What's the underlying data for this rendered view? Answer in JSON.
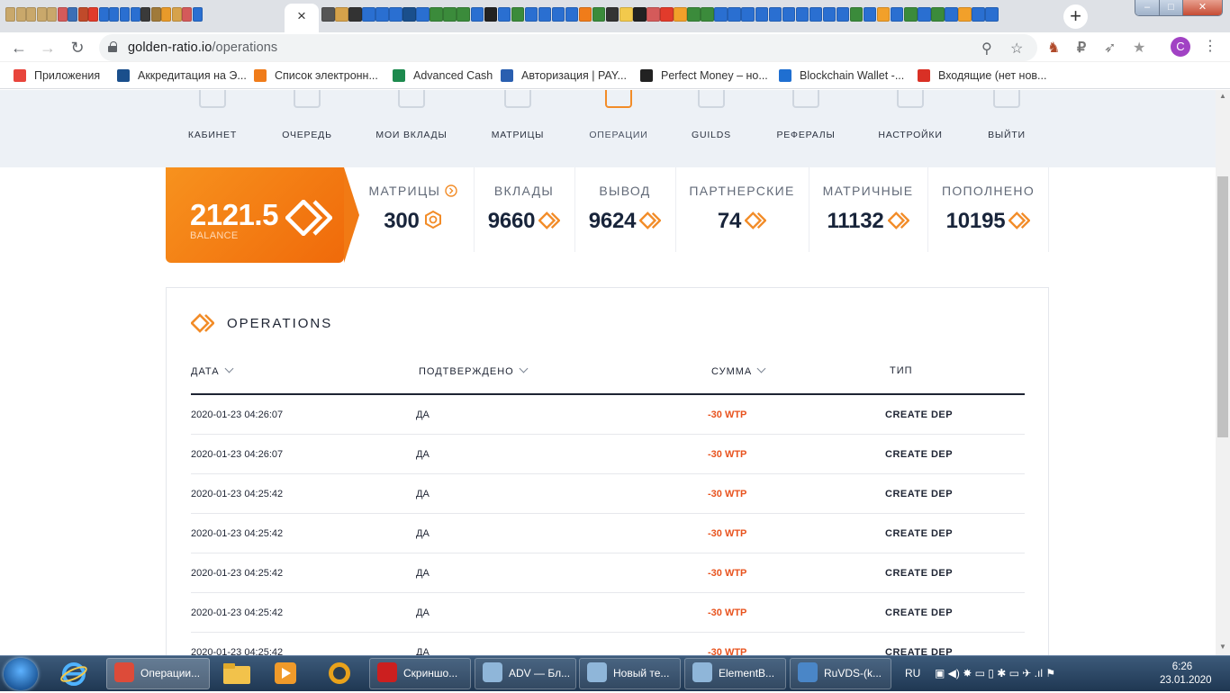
{
  "browser": {
    "active_tab_close": "×",
    "new_tab": "+",
    "url_host": "golden-ratio.io",
    "url_path": "/operations",
    "window_controls": {
      "minimize": "–",
      "maximize": "□",
      "close": "✕"
    },
    "profile_initial": "C"
  },
  "bookmarks": [
    {
      "label": "Приложения",
      "color": "#e8453c"
    },
    {
      "label": "Аккредитация на Э...",
      "color": "#1a4f8c"
    },
    {
      "label": "Список электронн...",
      "color": "#f07c1a"
    },
    {
      "label": "Advanced Cash",
      "color": "#1d8a4e"
    },
    {
      "label": "Авторизация | PAY...",
      "color": "#2a5fb0"
    },
    {
      "label": "Perfect Money – но...",
      "color": "#222222"
    },
    {
      "label": "Blockchain Wallet -...",
      "color": "#1f6fd1"
    },
    {
      "label": "Входящие (нет нов...",
      "color": "#d93025"
    }
  ],
  "nav": [
    {
      "label": "КАБИНЕТ",
      "active": false
    },
    {
      "label": "ОЧЕРЕДЬ",
      "active": false
    },
    {
      "label": "МОИ ВКЛАДЫ",
      "active": false
    },
    {
      "label": "МАТРИЦЫ",
      "active": false
    },
    {
      "label": "ОПЕРАЦИИ",
      "active": true
    },
    {
      "label": "GUILDS",
      "active": false
    },
    {
      "label": "РЕФЕРАЛЫ",
      "active": false
    },
    {
      "label": "НАСТРОЙКИ",
      "active": false
    },
    {
      "label": "ВЫЙТИ",
      "active": false
    }
  ],
  "balance": {
    "value": "2121.5",
    "label": "BALANCE"
  },
  "stats": [
    {
      "label": "МАТРИЦЫ",
      "value": "300",
      "icon": "hex-icon"
    },
    {
      "label": "ВКЛАДЫ",
      "value": "9660",
      "icon": "diamond-icon"
    },
    {
      "label": "ВЫВОД",
      "value": "9624",
      "icon": "diamond-icon"
    },
    {
      "label": "ПАРТНЕРСКИЕ",
      "value": "74",
      "icon": "diamond-icon"
    },
    {
      "label": "МАТРИЧНЫЕ",
      "value": "11132",
      "icon": "diamond-icon"
    },
    {
      "label": "ПОПОЛНЕНО",
      "value": "10195",
      "icon": "diamond-icon"
    }
  ],
  "operations": {
    "title": "OPERATIONS",
    "columns": [
      "ДАТА",
      "ПОДТВЕРЖДЕНО",
      "СУММА",
      "ТИП"
    ],
    "rows": [
      {
        "date": "2020-01-23 04:26:07",
        "confirmed": "ДА",
        "sum": "-30 WTP",
        "type": "CREATE DEP"
      },
      {
        "date": "2020-01-23 04:26:07",
        "confirmed": "ДА",
        "sum": "-30 WTP",
        "type": "CREATE DEP"
      },
      {
        "date": "2020-01-23 04:25:42",
        "confirmed": "ДА",
        "sum": "-30 WTP",
        "type": "CREATE DEP"
      },
      {
        "date": "2020-01-23 04:25:42",
        "confirmed": "ДА",
        "sum": "-30 WTP",
        "type": "CREATE DEP"
      },
      {
        "date": "2020-01-23 04:25:42",
        "confirmed": "ДА",
        "sum": "-30 WTP",
        "type": "CREATE DEP"
      },
      {
        "date": "2020-01-23 04:25:42",
        "confirmed": "ДА",
        "sum": "-30 WTP",
        "type": "CREATE DEP"
      },
      {
        "date": "2020-01-23 04:25:42",
        "confirmed": "ДА",
        "sum": "-30 WTP",
        "type": "CREATE DEP"
      }
    ]
  },
  "taskbar": {
    "items": [
      {
        "label": "Операции...",
        "color": "#dd4b39"
      },
      {
        "label": "Скриншо...",
        "color": "#cc1f1f"
      },
      {
        "label": "ADV — Бл...",
        "color": "#8fb6d9"
      },
      {
        "label": "Новый те...",
        "color": "#8fb6d9"
      },
      {
        "label": "ElementB...",
        "color": "#8fb6d9"
      },
      {
        "label": "RuVDS-(k...",
        "color": "#4a86c7"
      }
    ],
    "lang": "RU",
    "time": "6:26",
    "date": "23.01.2020"
  },
  "colors": {
    "accent": "#f28c28",
    "negative": "#e8531e",
    "text": "#1e2433"
  }
}
